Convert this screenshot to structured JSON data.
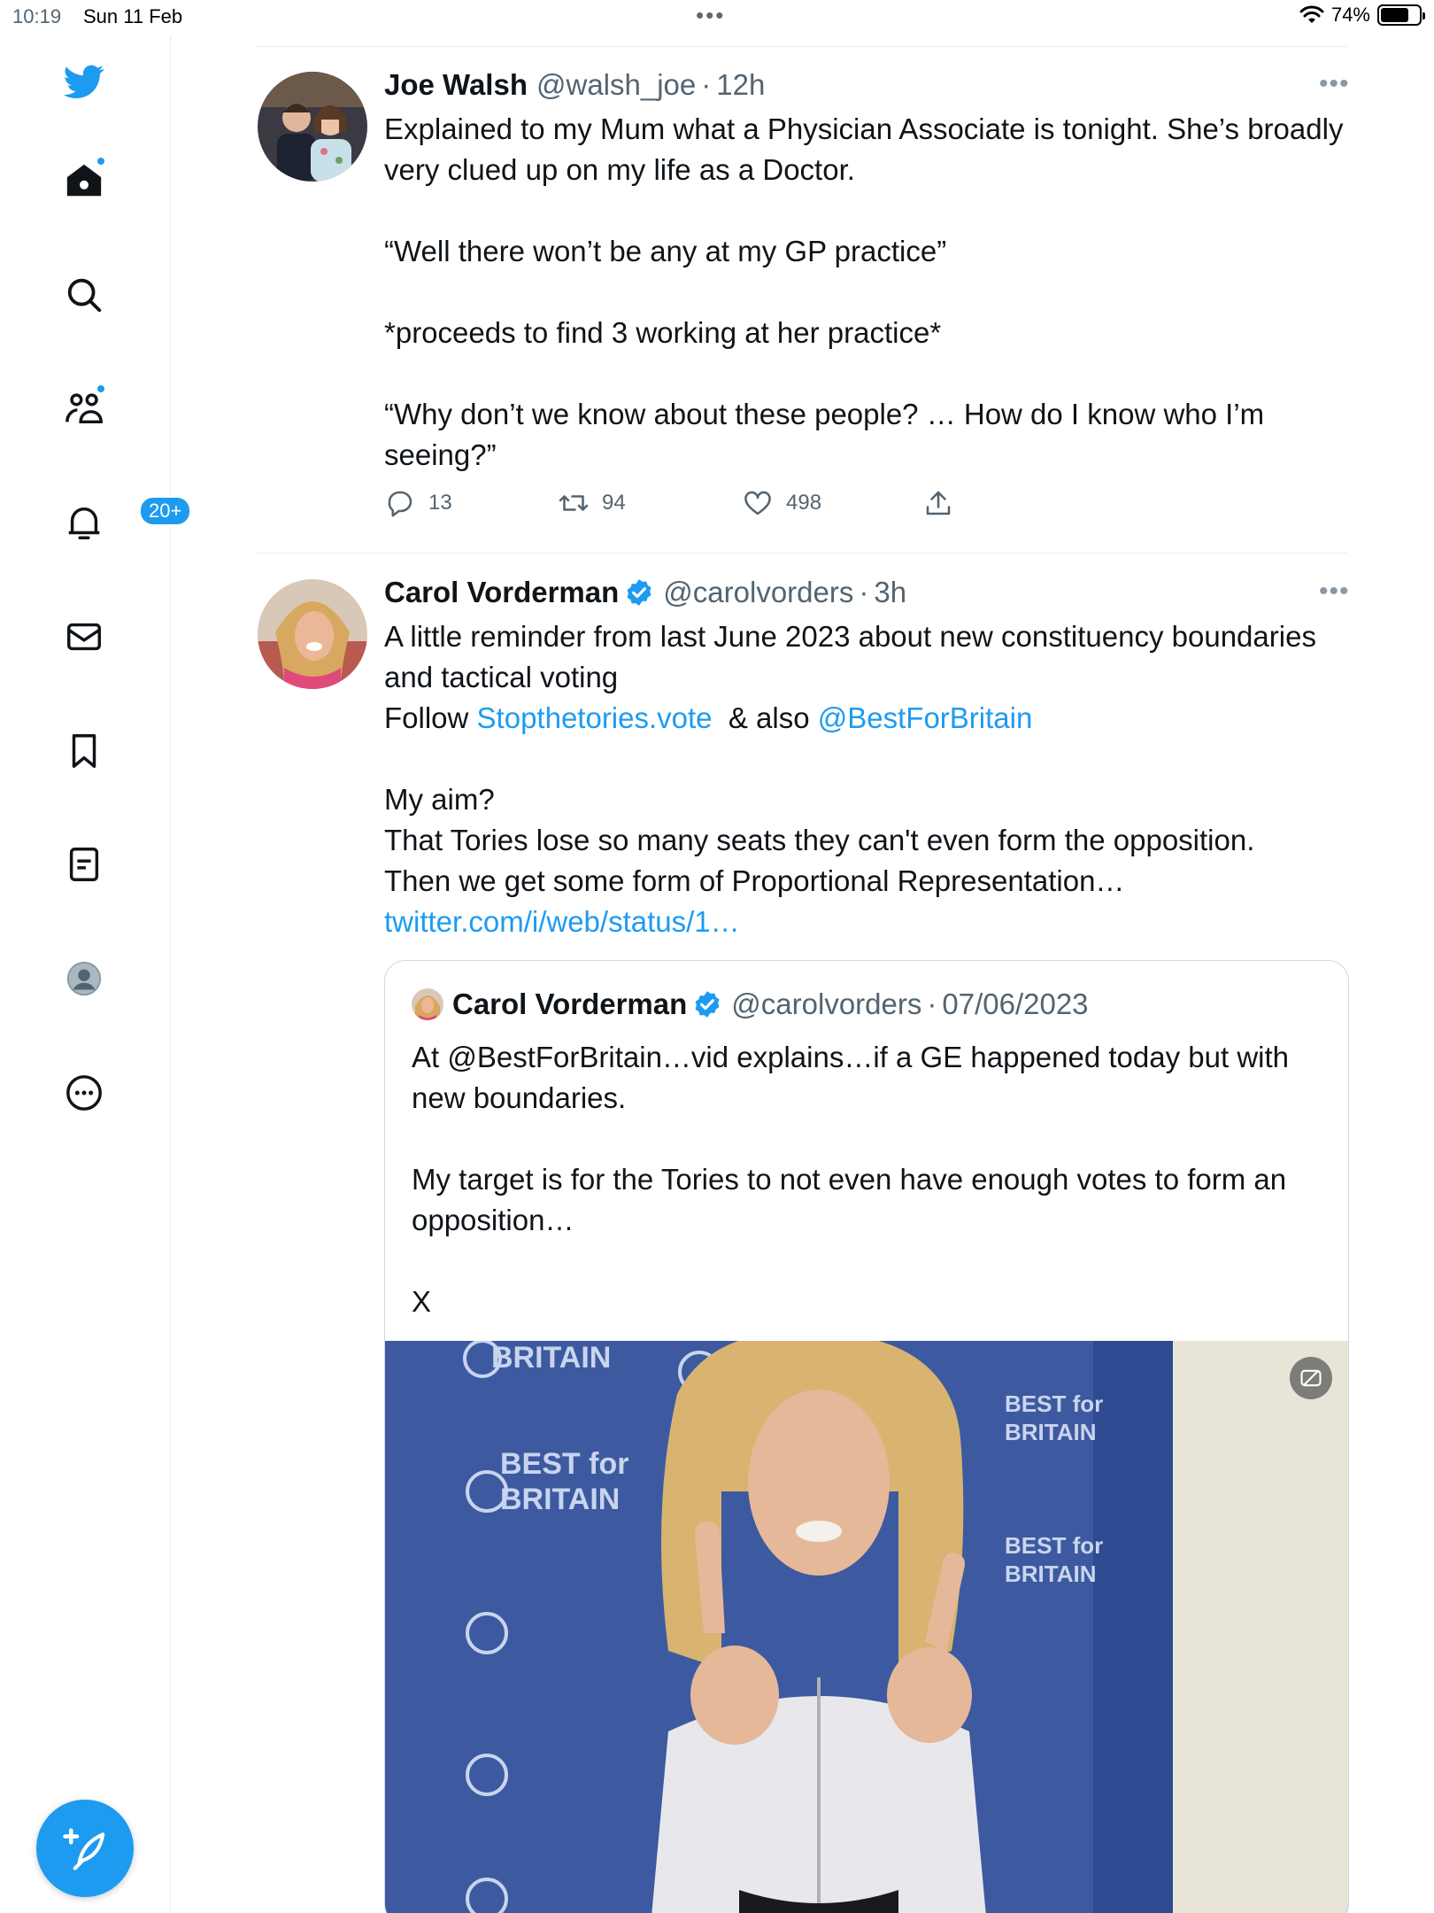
{
  "status_bar": {
    "time": "10:19",
    "date": "Sun 11 Feb",
    "battery": "74%",
    "battery_level": 0.74
  },
  "sidebar": {
    "items": [
      {
        "name": "twitter-logo"
      },
      {
        "name": "home"
      },
      {
        "name": "search"
      },
      {
        "name": "communities"
      },
      {
        "name": "notifications",
        "badge": "20+"
      },
      {
        "name": "messages"
      },
      {
        "name": "bookmarks"
      },
      {
        "name": "lists"
      },
      {
        "name": "profile"
      },
      {
        "name": "more"
      }
    ]
  },
  "tweets": [
    {
      "name": "Joe Walsh",
      "handle": "@walsh_joe",
      "sep": "·",
      "time": "12h",
      "lines": [
        "Explained to my Mum what a Physician Associate is tonight. She’s broadly very clued up on my life as a Doctor.",
        "",
        "“Well there won’t be any at my GP practice”",
        "",
        "*proceeds to find 3 working at her practice*",
        "",
        "“Why don’t we know about these people? … How do I know who I’m seeing?”"
      ],
      "replies": "13",
      "retweets": "94",
      "likes": "498"
    },
    {
      "name": "Carol Vorderman",
      "handle": "@carolvorders",
      "sep": "·",
      "time": "3h",
      "line1": "A little reminder from last June 2023 about new constituency boundaries and tactical voting",
      "follow_prefix": "Follow ",
      "follow_link": "Stopthetories.vote",
      "follow_mid": "  & also ",
      "follow_mention": "@BestForBritain",
      "aim": "My aim?",
      "line_tories": "That Tories lose so many seats they can't even form the opposition.",
      "line_pr": "Then we get some form of Proportional Representation… ",
      "pr_link": "twitter.com/i/web/status/1…",
      "quote": {
        "name": "Carol Vorderman",
        "handle": "@carolvorders",
        "sep": "·",
        "date": "07/06/2023",
        "lines": [
          "At @BestForBritain…vid explains…if a GE happened today but with new boundaries.",
          "",
          "My target is for the Tories to not even have enough votes to form an opposition…",
          "",
          "X"
        ],
        "media_text": [
          "BEST for",
          "BRITAIN"
        ]
      }
    }
  ],
  "colors": {
    "accent": "#1d9bf0",
    "text": "#0f1419",
    "secondary": "#536471",
    "border": "#e6ecf0"
  },
  "more_glyph": "•••"
}
